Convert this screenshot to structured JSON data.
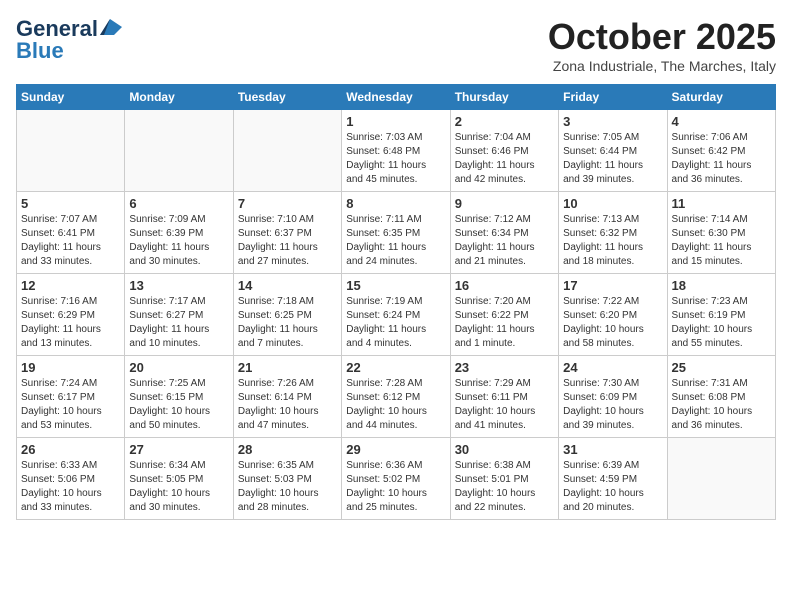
{
  "header": {
    "logo_general": "General",
    "logo_blue": "Blue",
    "month_title": "October 2025",
    "subtitle": "Zona Industriale, The Marches, Italy"
  },
  "weekdays": [
    "Sunday",
    "Monday",
    "Tuesday",
    "Wednesday",
    "Thursday",
    "Friday",
    "Saturday"
  ],
  "weeks": [
    [
      {
        "day": "",
        "info": ""
      },
      {
        "day": "",
        "info": ""
      },
      {
        "day": "",
        "info": ""
      },
      {
        "day": "1",
        "info": "Sunrise: 7:03 AM\nSunset: 6:48 PM\nDaylight: 11 hours\nand 45 minutes."
      },
      {
        "day": "2",
        "info": "Sunrise: 7:04 AM\nSunset: 6:46 PM\nDaylight: 11 hours\nand 42 minutes."
      },
      {
        "day": "3",
        "info": "Sunrise: 7:05 AM\nSunset: 6:44 PM\nDaylight: 11 hours\nand 39 minutes."
      },
      {
        "day": "4",
        "info": "Sunrise: 7:06 AM\nSunset: 6:42 PM\nDaylight: 11 hours\nand 36 minutes."
      }
    ],
    [
      {
        "day": "5",
        "info": "Sunrise: 7:07 AM\nSunset: 6:41 PM\nDaylight: 11 hours\nand 33 minutes."
      },
      {
        "day": "6",
        "info": "Sunrise: 7:09 AM\nSunset: 6:39 PM\nDaylight: 11 hours\nand 30 minutes."
      },
      {
        "day": "7",
        "info": "Sunrise: 7:10 AM\nSunset: 6:37 PM\nDaylight: 11 hours\nand 27 minutes."
      },
      {
        "day": "8",
        "info": "Sunrise: 7:11 AM\nSunset: 6:35 PM\nDaylight: 11 hours\nand 24 minutes."
      },
      {
        "day": "9",
        "info": "Sunrise: 7:12 AM\nSunset: 6:34 PM\nDaylight: 11 hours\nand 21 minutes."
      },
      {
        "day": "10",
        "info": "Sunrise: 7:13 AM\nSunset: 6:32 PM\nDaylight: 11 hours\nand 18 minutes."
      },
      {
        "day": "11",
        "info": "Sunrise: 7:14 AM\nSunset: 6:30 PM\nDaylight: 11 hours\nand 15 minutes."
      }
    ],
    [
      {
        "day": "12",
        "info": "Sunrise: 7:16 AM\nSunset: 6:29 PM\nDaylight: 11 hours\nand 13 minutes."
      },
      {
        "day": "13",
        "info": "Sunrise: 7:17 AM\nSunset: 6:27 PM\nDaylight: 11 hours\nand 10 minutes."
      },
      {
        "day": "14",
        "info": "Sunrise: 7:18 AM\nSunset: 6:25 PM\nDaylight: 11 hours\nand 7 minutes."
      },
      {
        "day": "15",
        "info": "Sunrise: 7:19 AM\nSunset: 6:24 PM\nDaylight: 11 hours\nand 4 minutes."
      },
      {
        "day": "16",
        "info": "Sunrise: 7:20 AM\nSunset: 6:22 PM\nDaylight: 11 hours\nand 1 minute."
      },
      {
        "day": "17",
        "info": "Sunrise: 7:22 AM\nSunset: 6:20 PM\nDaylight: 10 hours\nand 58 minutes."
      },
      {
        "day": "18",
        "info": "Sunrise: 7:23 AM\nSunset: 6:19 PM\nDaylight: 10 hours\nand 55 minutes."
      }
    ],
    [
      {
        "day": "19",
        "info": "Sunrise: 7:24 AM\nSunset: 6:17 PM\nDaylight: 10 hours\nand 53 minutes."
      },
      {
        "day": "20",
        "info": "Sunrise: 7:25 AM\nSunset: 6:15 PM\nDaylight: 10 hours\nand 50 minutes."
      },
      {
        "day": "21",
        "info": "Sunrise: 7:26 AM\nSunset: 6:14 PM\nDaylight: 10 hours\nand 47 minutes."
      },
      {
        "day": "22",
        "info": "Sunrise: 7:28 AM\nSunset: 6:12 PM\nDaylight: 10 hours\nand 44 minutes."
      },
      {
        "day": "23",
        "info": "Sunrise: 7:29 AM\nSunset: 6:11 PM\nDaylight: 10 hours\nand 41 minutes."
      },
      {
        "day": "24",
        "info": "Sunrise: 7:30 AM\nSunset: 6:09 PM\nDaylight: 10 hours\nand 39 minutes."
      },
      {
        "day": "25",
        "info": "Sunrise: 7:31 AM\nSunset: 6:08 PM\nDaylight: 10 hours\nand 36 minutes."
      }
    ],
    [
      {
        "day": "26",
        "info": "Sunrise: 6:33 AM\nSunset: 5:06 PM\nDaylight: 10 hours\nand 33 minutes."
      },
      {
        "day": "27",
        "info": "Sunrise: 6:34 AM\nSunset: 5:05 PM\nDaylight: 10 hours\nand 30 minutes."
      },
      {
        "day": "28",
        "info": "Sunrise: 6:35 AM\nSunset: 5:03 PM\nDaylight: 10 hours\nand 28 minutes."
      },
      {
        "day": "29",
        "info": "Sunrise: 6:36 AM\nSunset: 5:02 PM\nDaylight: 10 hours\nand 25 minutes."
      },
      {
        "day": "30",
        "info": "Sunrise: 6:38 AM\nSunset: 5:01 PM\nDaylight: 10 hours\nand 22 minutes."
      },
      {
        "day": "31",
        "info": "Sunrise: 6:39 AM\nSunset: 4:59 PM\nDaylight: 10 hours\nand 20 minutes."
      },
      {
        "day": "",
        "info": ""
      }
    ]
  ]
}
